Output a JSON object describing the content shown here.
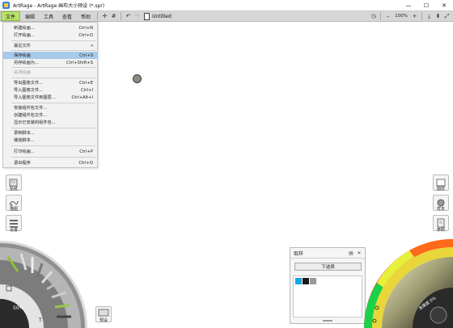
{
  "window": {
    "title": "ArtRage - ArtRage 画布大小预设 (*.spr)",
    "minimize": "—",
    "maximize": "☐",
    "close": "✕"
  },
  "menubar": {
    "tabs": [
      "文件",
      "编辑",
      "工具",
      "查看",
      "帮助"
    ],
    "document_name": "Untitled",
    "zoom": "100%"
  },
  "file_menu": {
    "items": [
      {
        "label": "新建绘画...",
        "shortcut": "Ctrl+N"
      },
      {
        "label": "打开绘画...",
        "shortcut": "Ctrl+O"
      },
      {
        "label": "最近文件",
        "shortcut": ">"
      },
      {
        "label": "保存绘画",
        "shortcut": "Ctrl+S"
      },
      {
        "label": "另存绘画为...",
        "shortcut": "Ctrl+Shift+S"
      },
      {
        "label": "关闭绘画",
        "shortcut": ""
      },
      {
        "label": "导出图像文件...",
        "shortcut": "Ctrl+E"
      },
      {
        "label": "导入图像文件...",
        "shortcut": "Ctrl+I"
      },
      {
        "label": "导入图像文件到图层...",
        "shortcut": "Ctrl+Alt+I"
      },
      {
        "label": "安装组件包文件...",
        "shortcut": ""
      },
      {
        "label": "创建组件包文件...",
        "shortcut": ""
      },
      {
        "label": "显示已安装的组件包...",
        "shortcut": ""
      },
      {
        "label": "录制脚本...",
        "shortcut": ""
      },
      {
        "label": "播放脚本...",
        "shortcut": ""
      },
      {
        "label": "打印绘画...",
        "shortcut": "Ctrl+P"
      },
      {
        "label": "退出程序",
        "shortcut": "Ctrl+Q"
      }
    ]
  },
  "left_panel": {
    "buttons": [
      "贴纸",
      "描图",
      "设置"
    ]
  },
  "tool_wheel": {
    "size_label": "50%"
  },
  "preset_button": "预设",
  "samples_panel": {
    "title": "取样",
    "button": "下选择",
    "swatches": [
      "#12a7e0",
      "#1a1a1a",
      "#9a9a9a"
    ]
  },
  "right_panel": {
    "buttons": [
      "图层",
      "样本",
      "参照"
    ]
  },
  "color_wheel": {
    "label": "金属度 0%"
  }
}
